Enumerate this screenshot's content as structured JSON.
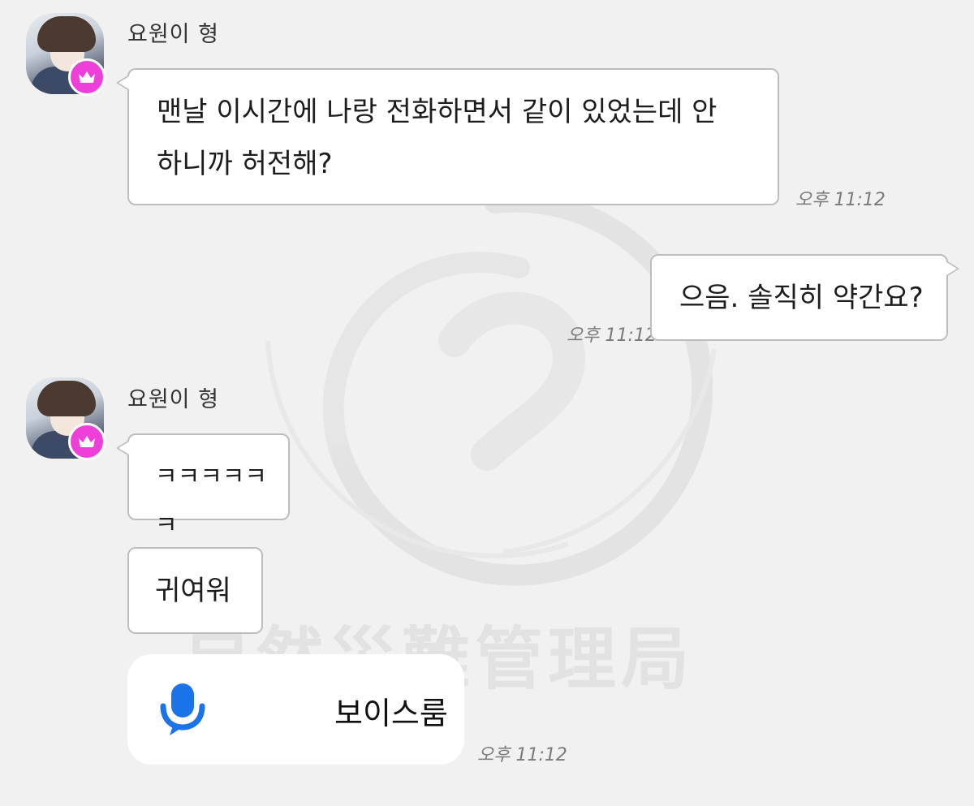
{
  "messages": [
    {
      "sender": "요원이 형",
      "lines": [
        "맨날 이시간에 나랑 전화하면서 같이 있었는데 안",
        "하니까 허전해?"
      ],
      "time": "오후 11:12"
    },
    {
      "sender": "",
      "text": "으음. 솔직히 약간요?",
      "time": "오후 11:12"
    },
    {
      "sender": "요원이 형",
      "text1": "ㅋㅋㅋㅋㅋㅋ",
      "text2": "귀여워"
    }
  ],
  "voice_room": {
    "label": "보이스룸",
    "time": "오후 11:12",
    "icon": "microphone-chat-icon",
    "accent_color": "#1a73e8"
  },
  "watermark": {
    "text": "自然災難管理局"
  },
  "colors": {
    "background": "#f1f1f1",
    "bubble_border": "#bdbdbd",
    "badge": "#ee3fd8"
  }
}
